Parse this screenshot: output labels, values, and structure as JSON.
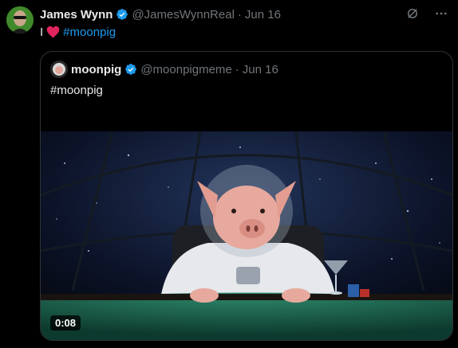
{
  "author": {
    "name": "James Wynn",
    "handle": "@JamesWynnReal",
    "separator": "·",
    "date": "Jun 16"
  },
  "tweet": {
    "prefix": "I",
    "hashtag": "#moonpig"
  },
  "quoted": {
    "name": "moonpig",
    "handle": "@moonpigmeme",
    "separator": "·",
    "date": "Jun 16",
    "text": "#moonpig",
    "video_time": "0:08"
  },
  "colors": {
    "accent": "#1d9bf0",
    "heart": "#f91880",
    "muted": "#71767b",
    "border": "#2f3336"
  },
  "icons": {
    "verified": "verified-badge-icon",
    "grok": "grok-icon",
    "more": "more-options-icon",
    "heart": "heart-emoji-icon"
  }
}
